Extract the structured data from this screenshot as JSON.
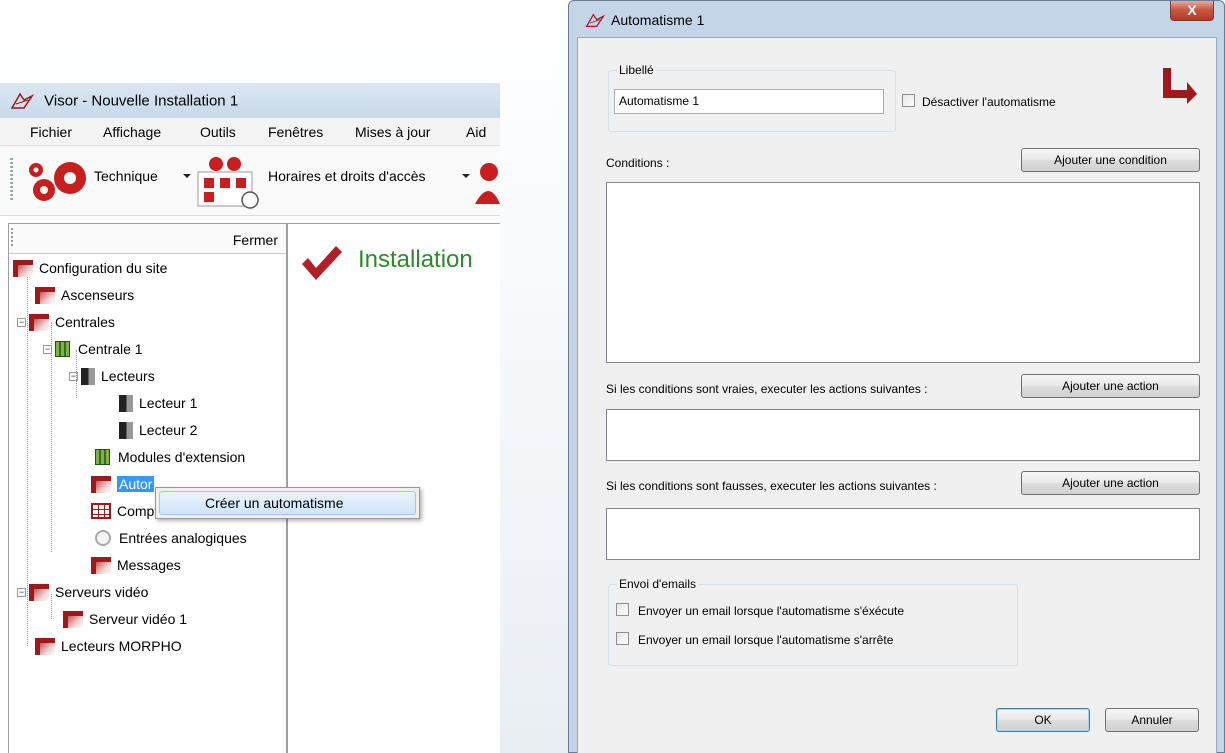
{
  "main_window": {
    "title": "Visor - Nouvelle Installation 1",
    "menu": [
      "Fichier",
      "Affichage",
      "Outils",
      "Fenêtres",
      "Mises à jour",
      "Aid"
    ],
    "toolbar": {
      "technique": "Technique",
      "horaires": "Horaires et droits d'accès"
    },
    "tree_header_close": "Fermer",
    "tree": [
      "Configuration du site",
      "Ascenseurs",
      "Centrales",
      "Centrale 1",
      "Lecteurs",
      "Lecteur 1",
      "Lecteur 2",
      "Modules d'extension",
      "Autor",
      "Compteurs",
      "Entrées analogiques",
      "Messages",
      "Serveurs vidéo",
      "Serveur vidéo 1",
      "Lecteurs MORPHO"
    ],
    "content_heading": "Installation",
    "context_menu": {
      "item": "Créer un automatisme"
    }
  },
  "dialog": {
    "title": "Automatisme 1",
    "close_label": "X",
    "libelle_group": "Libellé",
    "libelle_value": "Automatisme 1",
    "disable_label": "Désactiver l'automatisme",
    "disable_checked": false,
    "conditions_label": "Conditions :",
    "add_condition": "Ajouter une condition",
    "true_actions_label": "Si les conditions sont vraies, executer les actions suivantes :",
    "false_actions_label": "Si les conditions sont fausses, executer les actions suivantes :",
    "add_action": "Ajouter une action",
    "email_group": "Envoi d'emails",
    "email_on_run": "Envoyer un email lorsque l'automatisme s'éxécute",
    "email_on_stop": "Envoyer un email lorsque l'automatisme s'arrête",
    "ok": "OK",
    "cancel": "Annuler"
  },
  "colors": {
    "accent_red": "#9e1a1a",
    "selection": "#3399ff",
    "installation_green": "#2b8a2b"
  }
}
